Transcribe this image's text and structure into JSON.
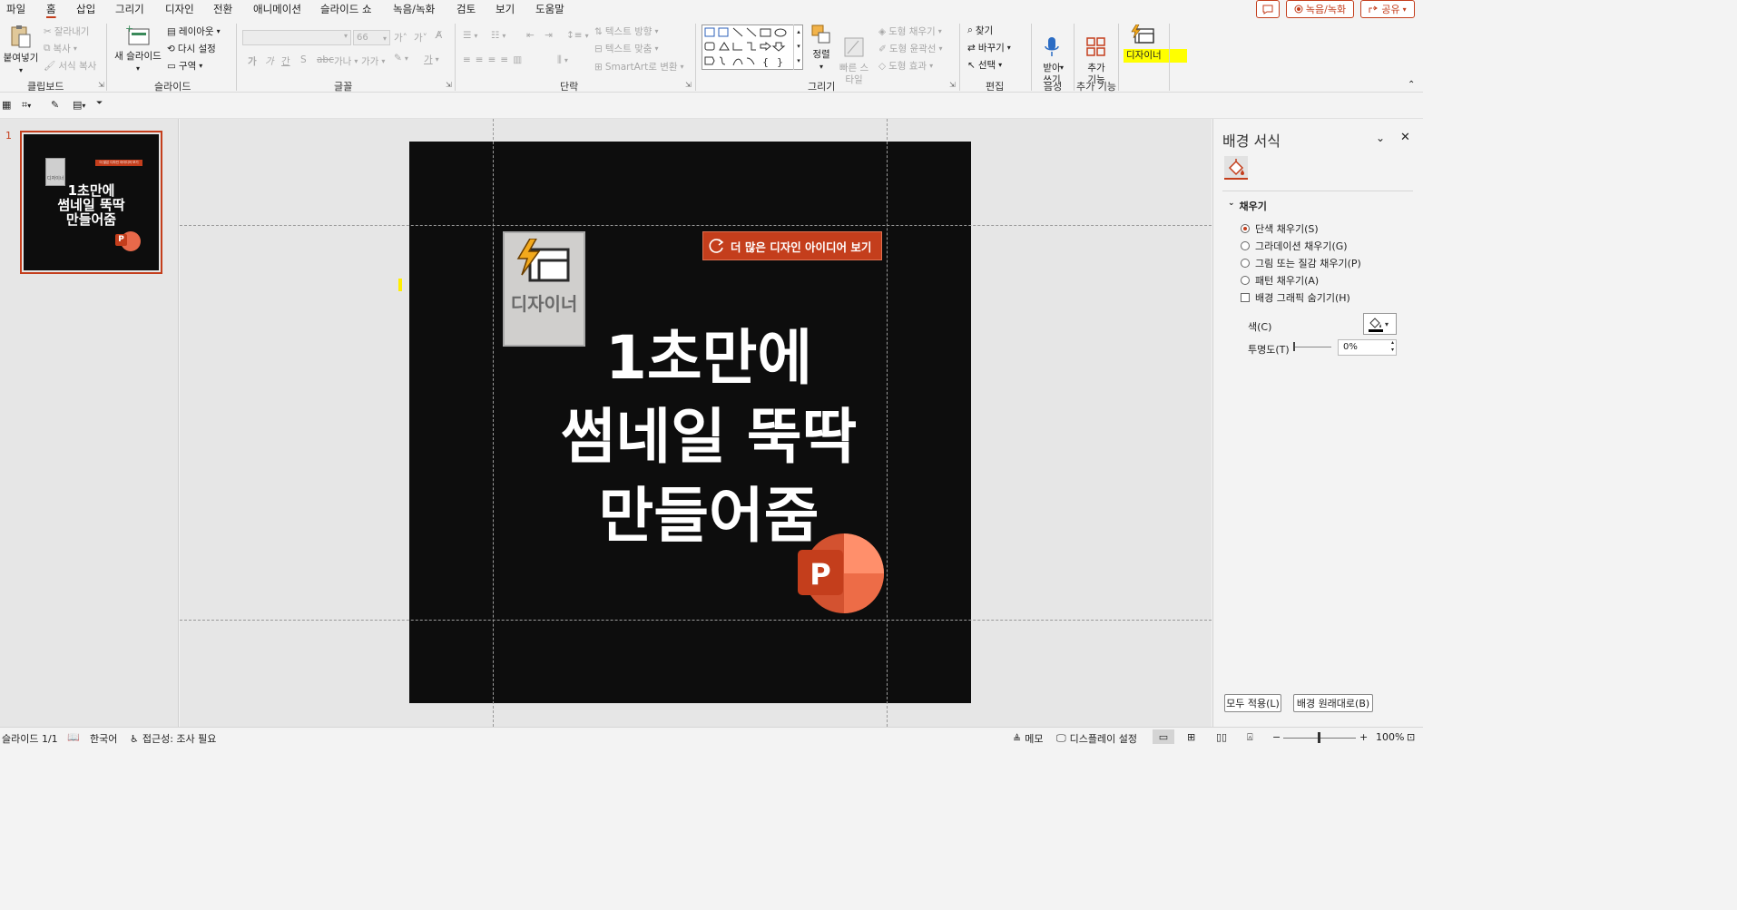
{
  "menu": {
    "tabs": [
      "파일",
      "홈",
      "삽입",
      "그리기",
      "디자인",
      "전환",
      "애니메이션",
      "슬라이드 쇼",
      "녹음/녹화",
      "검토",
      "보기",
      "도움말"
    ],
    "active": "홈",
    "record_label": "녹음/녹화",
    "share_label": "공유"
  },
  "ribbon": {
    "clipboard": {
      "paste": "붙여넣기",
      "cut": "잘라내기",
      "copy": "복사",
      "format_painter": "서식 복사",
      "label": "클립보드"
    },
    "slides": {
      "new_slide": "새 슬라이드",
      "layout": "레이아웃",
      "reset": "다시 설정",
      "section": "구역",
      "label": "슬라이드"
    },
    "font": {
      "font_size": "66",
      "grow": "가˄",
      "shrink": "가˅",
      "bold": "가",
      "italic": "가",
      "underline": "간",
      "strike": "S",
      "spacing": "가나",
      "case": "가가",
      "label": "글꼴"
    },
    "paragraph": {
      "text_direction": "텍스트 방향",
      "align_text": "텍스트 맞춤",
      "smartart": "SmartArt로 변환",
      "label": "단락"
    },
    "drawing": {
      "arrange": "정렬",
      "quick_styles": "빠른 스타일",
      "shape_fill": "도형 채우기",
      "shape_outline": "도형 윤곽선",
      "shape_effects": "도형 효과",
      "label": "그리기"
    },
    "editing": {
      "find": "찾기",
      "replace": "바꾸기",
      "select": "선택",
      "label": "편집"
    },
    "voice": {
      "dictate": "받아\n쓰기",
      "label": "음성"
    },
    "addins": {
      "addins": "추가\n기능",
      "label": "추가 기능"
    },
    "designer": {
      "label": "디자이너"
    }
  },
  "thumbnails": [
    {
      "number": "1",
      "title": "1초만에\n썸네일 뚝딱\n만들어줌",
      "banner": "더 많은 디자인 아이디어 보기",
      "designer": "디자이너",
      "selected": true
    }
  ],
  "slide": {
    "background": "#0d0d0d",
    "title_lines": [
      "1초만에",
      "썸네일 뚝딱",
      "만들어줌"
    ],
    "designer_icon_label": "디자이너",
    "banner_label": "더 많은 디자인 아이디어 보기",
    "logo_letter": "P"
  },
  "format_pane": {
    "title": "배경 서식",
    "section": "채우기",
    "options": [
      {
        "label": "단색 채우기(S)",
        "type": "radio",
        "checked": true
      },
      {
        "label": "그라데이션 채우기(G)",
        "type": "radio",
        "checked": false
      },
      {
        "label": "그림 또는 질감 채우기(P)",
        "type": "radio",
        "checked": false
      },
      {
        "label": "패턴 채우기(A)",
        "type": "radio",
        "checked": false
      },
      {
        "label": "배경 그래픽 숨기기(H)",
        "type": "checkbox",
        "checked": false
      }
    ],
    "color_label": "색(C)",
    "transparency_label": "투명도(T)",
    "transparency_value": "0%",
    "apply_all": "모두 적용(L)",
    "reset_bg": "배경 원래대로(B)"
  },
  "status": {
    "slide": "슬라이드 1/1",
    "language": "한국어",
    "accessibility": "접근성: 조사 필요",
    "notes": "메모",
    "display": "디스플레이 설정",
    "zoom": "100%"
  },
  "colors": {
    "accent": "#c43e1c",
    "highlight": "#ffff00"
  }
}
